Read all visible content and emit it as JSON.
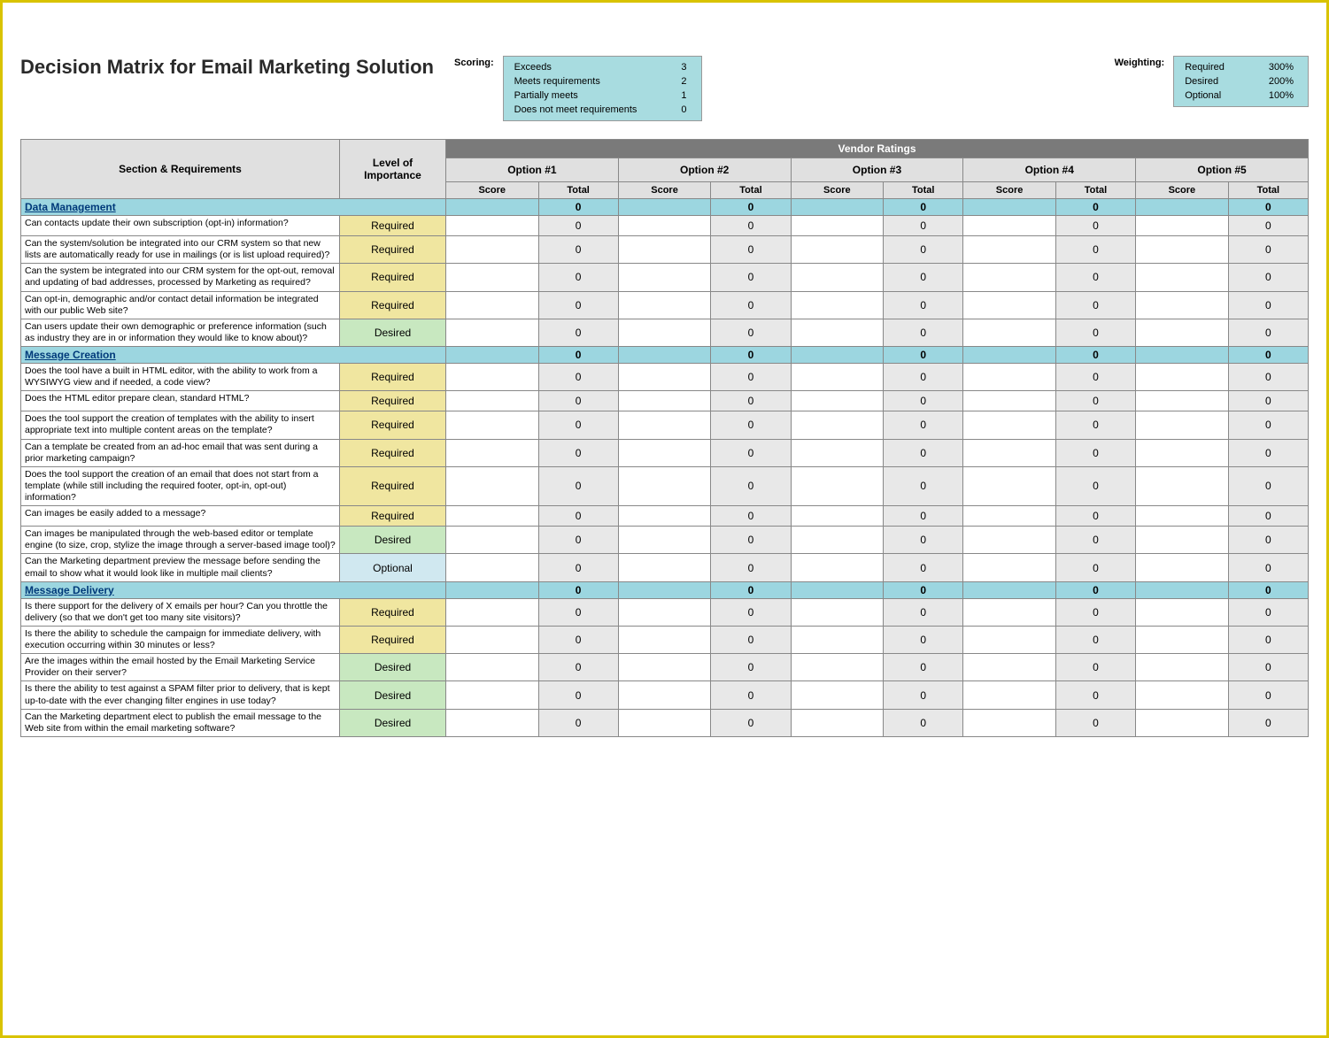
{
  "title": "Decision Matrix for Email Marketing Solution",
  "scoring": {
    "label": "Scoring:",
    "rows": [
      {
        "name": "Exceeds",
        "value": "3"
      },
      {
        "name": "Meets requirements",
        "value": "2"
      },
      {
        "name": "Partially meets",
        "value": "1"
      },
      {
        "name": "Does not meet requirements",
        "value": "0"
      }
    ]
  },
  "weighting": {
    "label": "Weighting:",
    "rows": [
      {
        "name": "Required",
        "value": "300%"
      },
      {
        "name": "Desired",
        "value": "200%"
      },
      {
        "name": "Optional",
        "value": "100%"
      }
    ]
  },
  "columns": {
    "section": "Section & Requirements",
    "importance": "Level of Importance",
    "vendor_header": "Vendor Ratings",
    "options": [
      "Option #1",
      "Option #2",
      "Option #3",
      "Option #4",
      "Option #5"
    ],
    "score": "Score",
    "total": "Total"
  },
  "sections": [
    {
      "name": "Data Management",
      "rows": [
        {
          "req": "Can contacts update their own subscription (opt-in) information?",
          "imp": "Required"
        },
        {
          "req": "Can the system/solution be integrated into our CRM system so that new lists are automatically ready for use in mailings (or is list upload required)?",
          "imp": "Required"
        },
        {
          "req": "Can the system be integrated into our CRM system for the opt-out, removal and updating of bad addresses, processed by Marketing as required?",
          "imp": "Required"
        },
        {
          "req": "Can opt-in, demographic and/or contact detail information be integrated with our public Web site?",
          "imp": "Required"
        },
        {
          "req": "Can users update their own demographic or preference information (such as industry they are in or information they would like to know about)?",
          "imp": "Desired"
        }
      ]
    },
    {
      "name": "Message Creation",
      "rows": [
        {
          "req": "Does the tool have a built in HTML editor, with the ability to work from a WYSIWYG view and if needed, a code view?",
          "imp": "Required"
        },
        {
          "req": "Does the HTML editor prepare clean, standard HTML?",
          "imp": "Required"
        },
        {
          "req": "Does the tool support the creation of templates with the ability to insert appropriate text into multiple content areas on the template?",
          "imp": "Required"
        },
        {
          "req": "Can a template be created from an ad-hoc email that was sent during a prior marketing campaign?",
          "imp": "Required"
        },
        {
          "req": "Does the tool support the creation of an email that does not start from a template (while still including the required footer, opt-in, opt-out) information?",
          "imp": "Required"
        },
        {
          "req": "Can images be easily added to a message?",
          "imp": "Required"
        },
        {
          "req": "Can images be manipulated through the web-based editor or template engine (to size, crop, stylize the image through a server-based image tool)?",
          "imp": "Desired"
        },
        {
          "req": "Can the Marketing department preview the message before sending the email to show what it would look like in multiple mail clients?",
          "imp": "Optional"
        }
      ]
    },
    {
      "name": "Message Delivery",
      "rows": [
        {
          "req": "Is there support for the delivery of X emails per hour?  Can you throttle the delivery (so that we don't get too many site visitors)?",
          "imp": "Required"
        },
        {
          "req": "Is there the ability to schedule the campaign for immediate delivery, with execution occurring within 30 minutes or less?",
          "imp": "Required"
        },
        {
          "req": "Are the images within the email hosted by the Email Marketing Service Provider on their server?",
          "imp": "Desired"
        },
        {
          "req": "Is there the ability to test against a SPAM filter prior to delivery, that is kept up-to-date with the ever changing filter engines in use today?",
          "imp": "Desired"
        },
        {
          "req": "Can the Marketing department elect to publish the email message to the Web site from within the email marketing software?",
          "imp": "Desired"
        }
      ]
    }
  ],
  "zero": "0"
}
